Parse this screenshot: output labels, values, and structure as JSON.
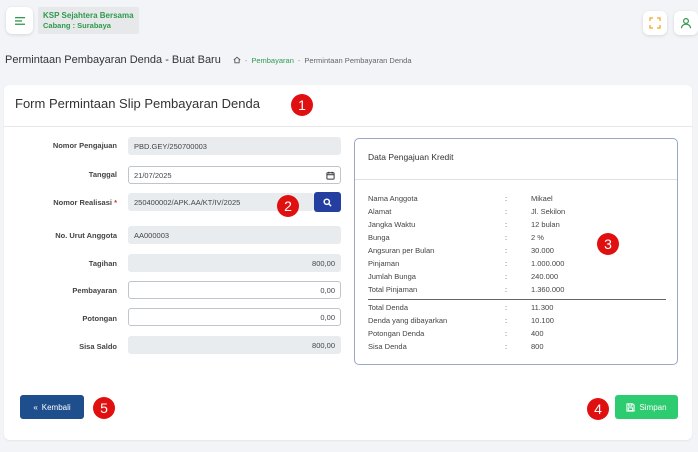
{
  "header": {
    "app_name": "KSP Sejahtera Bersama",
    "branch": "Cabang : Surabaya"
  },
  "page": {
    "title": "Permintaan Pembayaran Denda - Buat Baru",
    "breadcrumb": [
      "Pembayaran",
      "Permintaan Pembayaran Denda"
    ],
    "breadcrumb_sep": "-"
  },
  "form": {
    "title": "Form Permintaan Slip Pembayaran Denda",
    "fields": {
      "nomor_pengajuan": {
        "label": "Nomor Pengajuan",
        "value": "PBD.GEY/250700003"
      },
      "tanggal": {
        "label": "Tanggal",
        "value": "21/07/2025"
      },
      "nomor_realisasi": {
        "label": "Nomor Realisasi",
        "required_mark": "*",
        "value": "250400002/APK.AA/KT/IV/2025"
      },
      "no_urut_anggota": {
        "label": "No. Urut Anggota",
        "value": "AA000003"
      },
      "tagihan": {
        "label": "Tagihan",
        "value": "800,00"
      },
      "pembayaran": {
        "label": "Pembayaran",
        "value": "0,00"
      },
      "potongan": {
        "label": "Potongan",
        "value": "0,00"
      },
      "sisa_saldo": {
        "label": "Sisa Saldo",
        "value": "800,00"
      }
    }
  },
  "info": {
    "title": "Data Pengajuan Kredit",
    "separator": ":",
    "rows": [
      {
        "key": "Nama Anggota",
        "value": "Mikael"
      },
      {
        "key": "Alamat",
        "value": "Jl. Sekilon"
      },
      {
        "key": "Jangka Waktu",
        "value": "12 bulan"
      },
      {
        "key": "Bunga",
        "value": "2 %"
      },
      {
        "key": "Angsuran per Bulan",
        "value": "30.000"
      },
      {
        "key": "Pinjaman",
        "value": "1.000.000"
      },
      {
        "key": "Jumlah Bunga",
        "value": "240.000"
      },
      {
        "key": "Total Pinjaman",
        "value": "1.360.000"
      },
      {
        "key": "Total Denda",
        "value": "11.300"
      },
      {
        "key": "Denda yang dibayarkan",
        "value": "10.100"
      },
      {
        "key": "Potongan Denda",
        "value": "400"
      },
      {
        "key": "Sisa Denda",
        "value": "800"
      }
    ]
  },
  "buttons": {
    "back": "Kembali",
    "save": "Simpan"
  },
  "markers": [
    "1",
    "2",
    "3",
    "4",
    "5"
  ],
  "colors": {
    "brand_green": "#2e9a4d",
    "primary_blue": "#1f4e8c",
    "search_blue": "#243fa0",
    "save_green": "#2ecc71",
    "marker_red": "#e01010"
  }
}
